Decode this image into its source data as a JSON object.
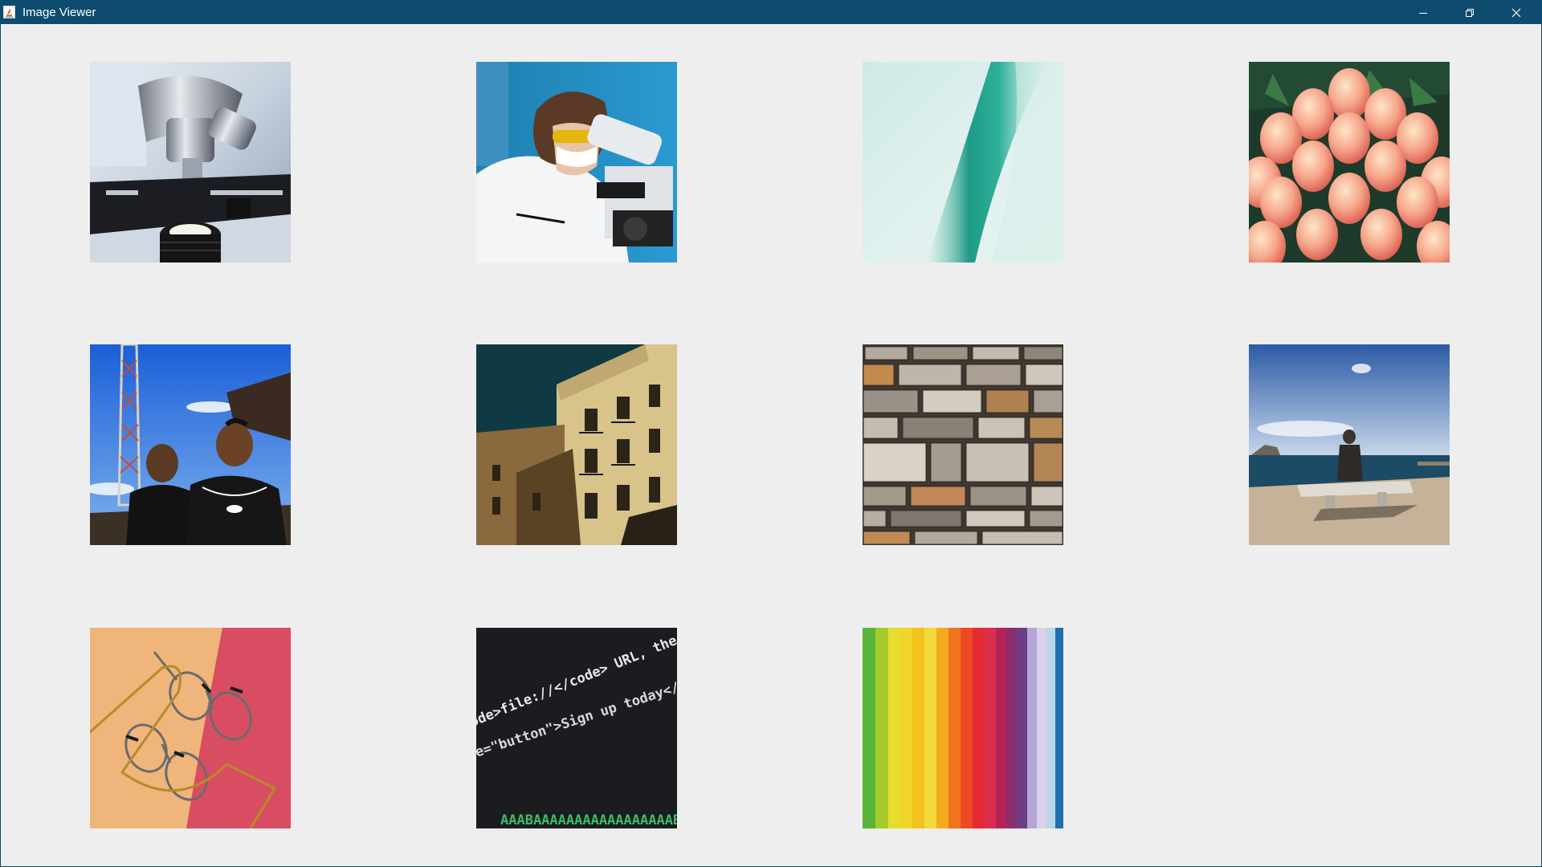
{
  "window": {
    "title": "Image Viewer"
  },
  "icons": {
    "app": "java-app-icon",
    "minimize": "minimize-icon",
    "maximize": "restore-icon",
    "close": "close-icon"
  },
  "colors": {
    "titlebar": "#0d4c6e",
    "content_background": "#eeeeee"
  },
  "thumbnails": [
    {
      "name": "microscope-closeup-image"
    },
    {
      "name": "scientist-at-microscope-image"
    },
    {
      "name": "teal-abstract-image"
    },
    {
      "name": "peaches-pile-image"
    },
    {
      "name": "two-men-outdoor-image"
    },
    {
      "name": "building-facade-image"
    },
    {
      "name": "stone-wall-image"
    },
    {
      "name": "person-by-sea-image"
    },
    {
      "name": "eyeglasses-image"
    },
    {
      "name": "code-screen-image"
    },
    {
      "name": "rainbow-stripes-image"
    }
  ],
  "code_screen": {
    "line1": "<code>file://</code> URL, the \"next\" j",
    "line2": "r role=\"button\">Sign up today</a></p>",
    "line3": "AAABAAAAAAAAAAAAAAAAABAAEAAAICT"
  }
}
